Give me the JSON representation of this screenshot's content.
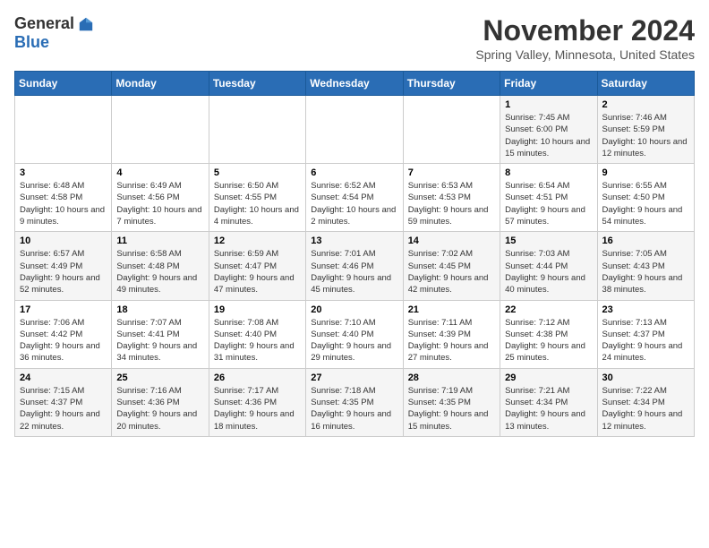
{
  "logo": {
    "general": "General",
    "blue": "Blue"
  },
  "title": "November 2024",
  "location": "Spring Valley, Minnesota, United States",
  "days_of_week": [
    "Sunday",
    "Monday",
    "Tuesday",
    "Wednesday",
    "Thursday",
    "Friday",
    "Saturday"
  ],
  "weeks": [
    [
      {
        "day": "",
        "info": ""
      },
      {
        "day": "",
        "info": ""
      },
      {
        "day": "",
        "info": ""
      },
      {
        "day": "",
        "info": ""
      },
      {
        "day": "",
        "info": ""
      },
      {
        "day": "1",
        "info": "Sunrise: 7:45 AM\nSunset: 6:00 PM\nDaylight: 10 hours and 15 minutes."
      },
      {
        "day": "2",
        "info": "Sunrise: 7:46 AM\nSunset: 5:59 PM\nDaylight: 10 hours and 12 minutes."
      }
    ],
    [
      {
        "day": "3",
        "info": "Sunrise: 6:48 AM\nSunset: 4:58 PM\nDaylight: 10 hours and 9 minutes."
      },
      {
        "day": "4",
        "info": "Sunrise: 6:49 AM\nSunset: 4:56 PM\nDaylight: 10 hours and 7 minutes."
      },
      {
        "day": "5",
        "info": "Sunrise: 6:50 AM\nSunset: 4:55 PM\nDaylight: 10 hours and 4 minutes."
      },
      {
        "day": "6",
        "info": "Sunrise: 6:52 AM\nSunset: 4:54 PM\nDaylight: 10 hours and 2 minutes."
      },
      {
        "day": "7",
        "info": "Sunrise: 6:53 AM\nSunset: 4:53 PM\nDaylight: 9 hours and 59 minutes."
      },
      {
        "day": "8",
        "info": "Sunrise: 6:54 AM\nSunset: 4:51 PM\nDaylight: 9 hours and 57 minutes."
      },
      {
        "day": "9",
        "info": "Sunrise: 6:55 AM\nSunset: 4:50 PM\nDaylight: 9 hours and 54 minutes."
      }
    ],
    [
      {
        "day": "10",
        "info": "Sunrise: 6:57 AM\nSunset: 4:49 PM\nDaylight: 9 hours and 52 minutes."
      },
      {
        "day": "11",
        "info": "Sunrise: 6:58 AM\nSunset: 4:48 PM\nDaylight: 9 hours and 49 minutes."
      },
      {
        "day": "12",
        "info": "Sunrise: 6:59 AM\nSunset: 4:47 PM\nDaylight: 9 hours and 47 minutes."
      },
      {
        "day": "13",
        "info": "Sunrise: 7:01 AM\nSunset: 4:46 PM\nDaylight: 9 hours and 45 minutes."
      },
      {
        "day": "14",
        "info": "Sunrise: 7:02 AM\nSunset: 4:45 PM\nDaylight: 9 hours and 42 minutes."
      },
      {
        "day": "15",
        "info": "Sunrise: 7:03 AM\nSunset: 4:44 PM\nDaylight: 9 hours and 40 minutes."
      },
      {
        "day": "16",
        "info": "Sunrise: 7:05 AM\nSunset: 4:43 PM\nDaylight: 9 hours and 38 minutes."
      }
    ],
    [
      {
        "day": "17",
        "info": "Sunrise: 7:06 AM\nSunset: 4:42 PM\nDaylight: 9 hours and 36 minutes."
      },
      {
        "day": "18",
        "info": "Sunrise: 7:07 AM\nSunset: 4:41 PM\nDaylight: 9 hours and 34 minutes."
      },
      {
        "day": "19",
        "info": "Sunrise: 7:08 AM\nSunset: 4:40 PM\nDaylight: 9 hours and 31 minutes."
      },
      {
        "day": "20",
        "info": "Sunrise: 7:10 AM\nSunset: 4:40 PM\nDaylight: 9 hours and 29 minutes."
      },
      {
        "day": "21",
        "info": "Sunrise: 7:11 AM\nSunset: 4:39 PM\nDaylight: 9 hours and 27 minutes."
      },
      {
        "day": "22",
        "info": "Sunrise: 7:12 AM\nSunset: 4:38 PM\nDaylight: 9 hours and 25 minutes."
      },
      {
        "day": "23",
        "info": "Sunrise: 7:13 AM\nSunset: 4:37 PM\nDaylight: 9 hours and 24 minutes."
      }
    ],
    [
      {
        "day": "24",
        "info": "Sunrise: 7:15 AM\nSunset: 4:37 PM\nDaylight: 9 hours and 22 minutes."
      },
      {
        "day": "25",
        "info": "Sunrise: 7:16 AM\nSunset: 4:36 PM\nDaylight: 9 hours and 20 minutes."
      },
      {
        "day": "26",
        "info": "Sunrise: 7:17 AM\nSunset: 4:36 PM\nDaylight: 9 hours and 18 minutes."
      },
      {
        "day": "27",
        "info": "Sunrise: 7:18 AM\nSunset: 4:35 PM\nDaylight: 9 hours and 16 minutes."
      },
      {
        "day": "28",
        "info": "Sunrise: 7:19 AM\nSunset: 4:35 PM\nDaylight: 9 hours and 15 minutes."
      },
      {
        "day": "29",
        "info": "Sunrise: 7:21 AM\nSunset: 4:34 PM\nDaylight: 9 hours and 13 minutes."
      },
      {
        "day": "30",
        "info": "Sunrise: 7:22 AM\nSunset: 4:34 PM\nDaylight: 9 hours and 12 minutes."
      }
    ]
  ]
}
